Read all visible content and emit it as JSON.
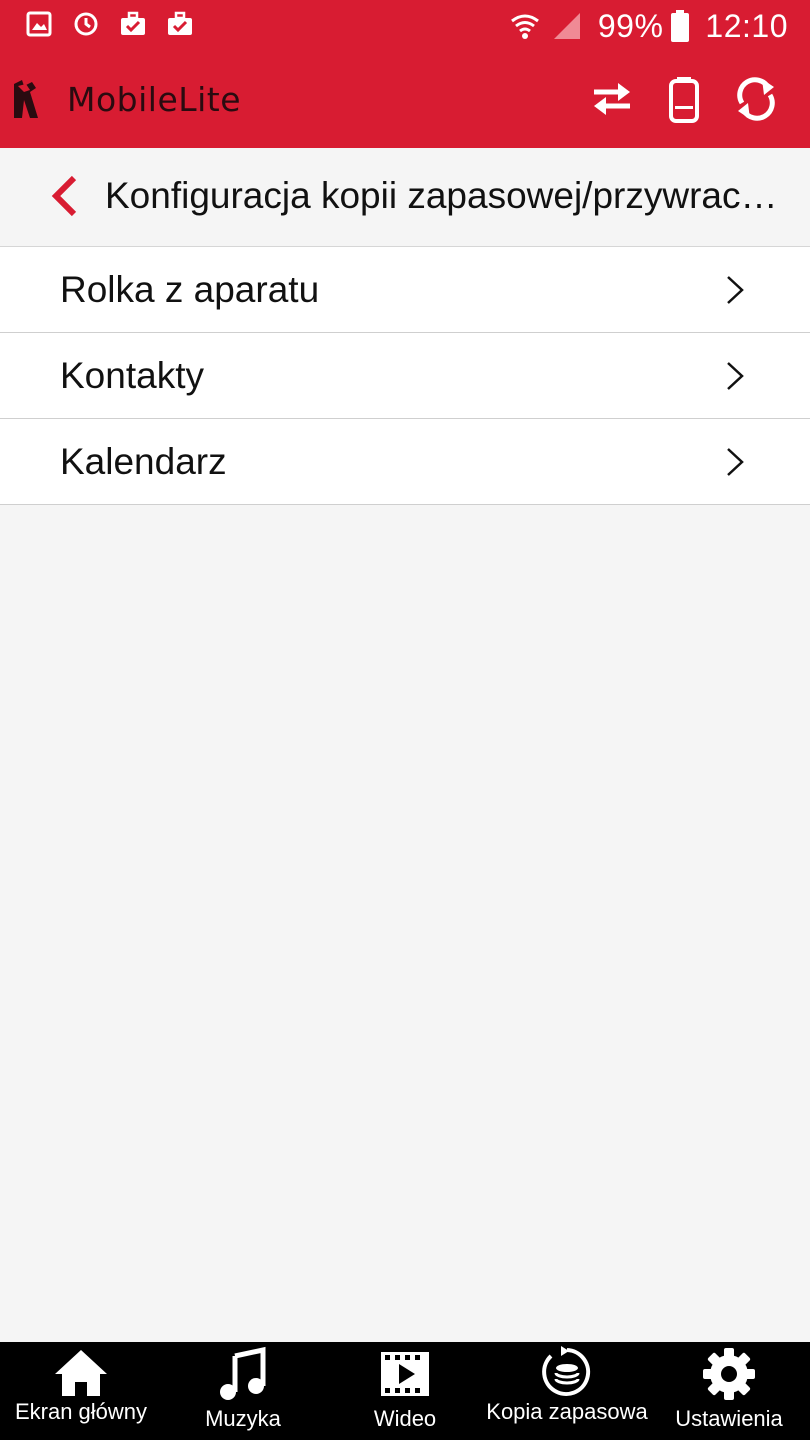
{
  "status_bar": {
    "battery": "99%",
    "time": "12:10",
    "left_icons": [
      "gallery-icon",
      "sync-icon",
      "briefcase-check-icon",
      "briefcase-check-icon"
    ],
    "right_icons": [
      "wifi-icon",
      "signal-icon",
      "battery-icon"
    ]
  },
  "app_bar": {
    "title": "MobileLite",
    "logo": "kingston-logo",
    "actions": [
      "transfer-icon",
      "device-icon",
      "refresh-icon"
    ]
  },
  "header": {
    "title": "Konfiguracja kopii zapasowej/przywrac…"
  },
  "list": {
    "items": [
      {
        "label": "Rolka z aparatu"
      },
      {
        "label": "Kontakty"
      },
      {
        "label": "Kalendarz"
      }
    ]
  },
  "bottom_nav": {
    "items": [
      {
        "label": "Ekran główny",
        "icon": "home-icon"
      },
      {
        "label": "Muzyka",
        "icon": "music-icon"
      },
      {
        "label": "Wideo",
        "icon": "video-icon"
      },
      {
        "label": "Kopia zapasowa",
        "icon": "backup-icon"
      },
      {
        "label": "Ustawienia",
        "icon": "settings-icon"
      }
    ]
  },
  "colors": {
    "brand_red": "#d81c32",
    "nav_background": "#000000",
    "background": "#f5f5f5"
  }
}
